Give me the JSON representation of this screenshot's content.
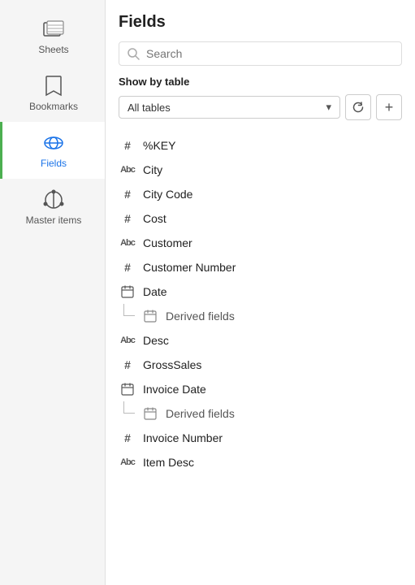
{
  "sidebar": {
    "items": [
      {
        "id": "sheets",
        "label": "Sheets",
        "icon": "sheets-icon",
        "active": false
      },
      {
        "id": "bookmarks",
        "label": "Bookmarks",
        "icon": "bookmarks-icon",
        "active": false
      },
      {
        "id": "fields",
        "label": "Fields",
        "icon": "fields-icon",
        "active": true
      },
      {
        "id": "master-items",
        "label": "Master items",
        "icon": "master-items-icon",
        "active": false
      }
    ]
  },
  "main": {
    "title": "Fields",
    "search": {
      "placeholder": "Search",
      "value": ""
    },
    "show_by_table": {
      "label": "Show by table",
      "dropdown_value": "All tables",
      "dropdown_options": [
        "All tables"
      ]
    },
    "fields": [
      {
        "id": "key",
        "label": "%KEY",
        "type": "number",
        "derived": false
      },
      {
        "id": "city",
        "label": "City",
        "type": "text",
        "derived": false
      },
      {
        "id": "city-code",
        "label": "City Code",
        "type": "number",
        "derived": false
      },
      {
        "id": "cost",
        "label": "Cost",
        "type": "number",
        "derived": false
      },
      {
        "id": "customer",
        "label": "Customer",
        "type": "text",
        "derived": false
      },
      {
        "id": "customer-number",
        "label": "Customer Number",
        "type": "number",
        "derived": false
      },
      {
        "id": "date",
        "label": "Date",
        "type": "date",
        "derived": false
      },
      {
        "id": "derived-fields-1",
        "label": "Derived fields",
        "type": "date",
        "derived": true
      },
      {
        "id": "desc",
        "label": "Desc",
        "type": "text",
        "derived": false
      },
      {
        "id": "gross-sales",
        "label": "GrossSales",
        "type": "number",
        "derived": false
      },
      {
        "id": "invoice-date",
        "label": "Invoice Date",
        "type": "date",
        "derived": false
      },
      {
        "id": "derived-fields-2",
        "label": "Derived fields",
        "type": "date",
        "derived": true
      },
      {
        "id": "invoice-number",
        "label": "Invoice Number",
        "type": "number",
        "derived": false
      },
      {
        "id": "item-desc",
        "label": "Item Desc",
        "type": "text",
        "derived": false
      }
    ]
  },
  "buttons": {
    "refresh_label": "↺",
    "add_label": "+"
  }
}
